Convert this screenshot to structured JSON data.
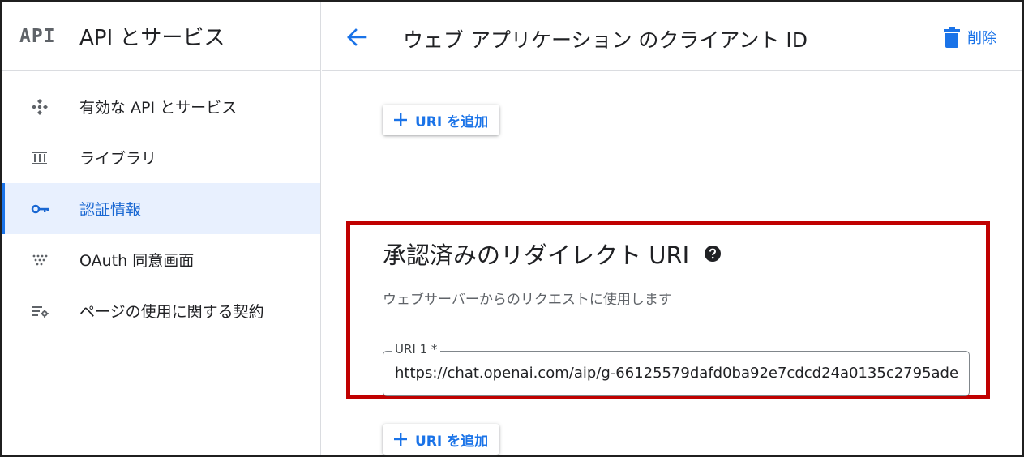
{
  "sidebar": {
    "logo": "API",
    "title": "API とサービス",
    "items": [
      {
        "label": "有効な API とサービス",
        "icon": "api-hub-icon",
        "active": false
      },
      {
        "label": "ライブラリ",
        "icon": "library-icon",
        "active": false
      },
      {
        "label": "認証情報",
        "icon": "key-icon",
        "active": true
      },
      {
        "label": "OAuth 同意画面",
        "icon": "consent-dots-icon",
        "active": false
      },
      {
        "label": "ページの使用に関する契約",
        "icon": "settings-list-icon",
        "active": false
      }
    ]
  },
  "header": {
    "title": "ウェブ アプリケーション のクライアント ID",
    "delete_label": "削除"
  },
  "main": {
    "add_uri_label": "URI を追加",
    "redirect_section": {
      "title": "承認済みのリダイレクト URI",
      "subtitle": "ウェブサーバーからのリクエストに使用します",
      "field_label": "URI 1 *",
      "field_value": "https://chat.openai.com/aip/g-66125579dafd0ba92e7cdcd24a0135c2795ade"
    }
  },
  "colors": {
    "accent": "#1a73e8",
    "active_bg": "#e8f0fe",
    "highlight": "#c00000"
  }
}
